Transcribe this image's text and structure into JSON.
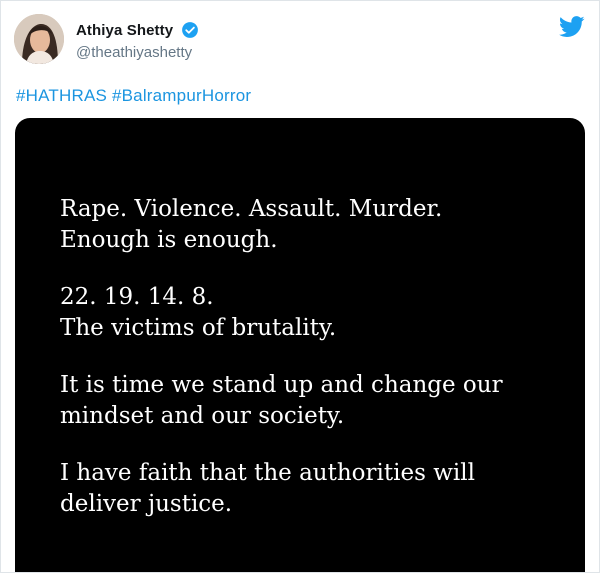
{
  "tweet": {
    "author": {
      "name": "Athiya Shetty",
      "handle": "@theathiyashetty",
      "verified": true
    },
    "hashtags": [
      "#HATHRAS",
      "#BalrampurHorror"
    ],
    "image_text": {
      "paragraphs": [
        [
          "Rape. Violence. Assault. Murder.",
          "Enough is enough."
        ],
        [
          "22. 19. 14. 8.",
          "The victims of brutality."
        ],
        [
          "It is time we stand up and change our",
          "mindset and our society."
        ],
        [
          "I have faith that the authorities will",
          "deliver justice."
        ]
      ]
    }
  },
  "colors": {
    "link": "#1b95e0",
    "twitter_blue": "#1da1f2",
    "name": "#14171a",
    "handle": "#657786",
    "image_bg": "#000000",
    "image_text": "#ffffff"
  },
  "icons": {
    "verified": "verified-badge-icon",
    "brand": "twitter-bird-icon"
  }
}
